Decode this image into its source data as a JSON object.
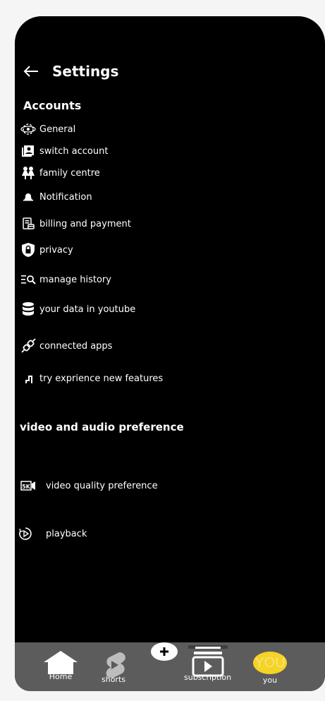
{
  "header": {
    "title": "Settings",
    "back_icon": "arrow-left-icon"
  },
  "accounts": {
    "heading": "Accounts",
    "items": [
      {
        "label": "General",
        "icon": "gear-eye-icon"
      },
      {
        "label": "switch account",
        "icon": "switch-account-icon"
      },
      {
        "label": "family centre",
        "icon": "family-icon"
      },
      {
        "label": "Notification",
        "icon": "bell-icon"
      },
      {
        "label": "billing and payment",
        "icon": "billing-icon"
      },
      {
        "label": "privacy",
        "icon": "privacy-shield-icon"
      },
      {
        "label": "manage history",
        "icon": "history-search-icon"
      },
      {
        "label": "your data in youtube",
        "icon": "database-icon"
      },
      {
        "label": "connected apps",
        "icon": "plug-icon"
      },
      {
        "label": "try exprience new features",
        "icon": "steps-icon"
      }
    ]
  },
  "video_audio": {
    "heading": "video and audio preference",
    "items": [
      {
        "label": "video quality preference",
        "icon": "hd-video-icon"
      },
      {
        "label": "playback",
        "icon": "playback-icon"
      }
    ]
  },
  "bottom_nav": {
    "home": "Home",
    "shorts": "shorts",
    "create_icon": "plus-icon",
    "subscription": "subscription",
    "you": "you",
    "you_avatar_text": "YOU"
  },
  "colors": {
    "background": "#000000",
    "nav_bar": "#5c5c5c",
    "avatar": "#f5d327",
    "text": "#ffffff"
  }
}
